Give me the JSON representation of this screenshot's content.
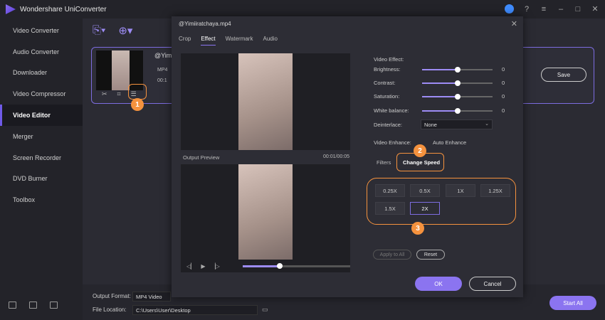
{
  "app": {
    "title": "Wondershare UniConverter"
  },
  "sidebar": {
    "items": [
      {
        "label": "Video Converter"
      },
      {
        "label": "Audio Converter"
      },
      {
        "label": "Downloader"
      },
      {
        "label": "Video Compressor"
      },
      {
        "label": "Video Editor",
        "active": true
      },
      {
        "label": "Merger"
      },
      {
        "label": "Screen Recorder"
      },
      {
        "label": "DVD Burner"
      },
      {
        "label": "Toolbox"
      }
    ]
  },
  "card": {
    "name": "@YimJ",
    "line1": "MP4",
    "line2": "00:1",
    "save_label": "Save"
  },
  "bottom": {
    "format_label": "Output Format:",
    "format_value": "MP4 Video",
    "location_label": "File Location:",
    "location_value": "C:\\Users\\User\\Desktop",
    "start_all": "Start All"
  },
  "dialog": {
    "title": "@Yimiiratchaya.mp4",
    "tabs": [
      "Crop",
      "Effect",
      "Watermark",
      "Audio"
    ],
    "active_tab": "Effect",
    "output_preview_label": "Output Preview",
    "output_time": "00:01/00:05",
    "playback_progress": 0.33,
    "effect_header": "Video Effect:",
    "effects": [
      {
        "label": "Brightness:",
        "value": "0",
        "level": 0.5
      },
      {
        "label": "Contrast:",
        "value": "0",
        "level": 0.5
      },
      {
        "label": "Saturation:",
        "value": "0",
        "level": 0.5
      },
      {
        "label": "White balance:",
        "value": "0",
        "level": 0.5
      }
    ],
    "deinterlace_label": "Deinterlace:",
    "deinterlace_value": "None",
    "enhance_label": "Video Enhance:",
    "auto_enhance": "Auto Enhance",
    "filters_tab": "Filters",
    "speed_tab": "Change Speed",
    "speeds": [
      "0.25X",
      "0.5X",
      "1X",
      "1.25X",
      "1.5X",
      "2X"
    ],
    "selected_speed": "2X",
    "apply_all": "Apply to All",
    "reset": "Reset",
    "ok": "OK",
    "cancel": "Cancel"
  },
  "callouts": [
    "1",
    "2",
    "3"
  ],
  "colors": {
    "accent": "#8b74f0",
    "callout": "#f5923e"
  }
}
